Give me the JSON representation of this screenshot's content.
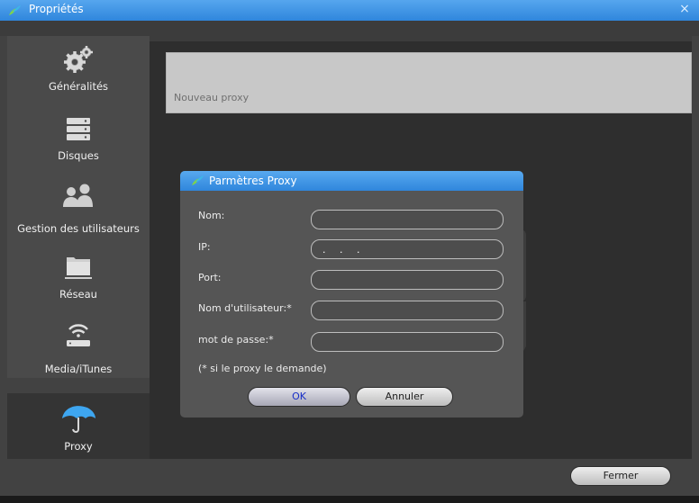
{
  "window": {
    "title": "Propriétés",
    "close": "×"
  },
  "sidebar": {
    "items": [
      {
        "label": "Généralités",
        "icon": "gears-icon"
      },
      {
        "label": "Disques",
        "icon": "server-disks-icon"
      },
      {
        "label": "Gestion des utilisateurs",
        "icon": "users-icon"
      },
      {
        "label": "Réseau",
        "icon": "network-folder-icon"
      },
      {
        "label": "Media/iTunes",
        "icon": "wifi-router-icon"
      },
      {
        "label": "Proxy",
        "icon": "umbrella-icon",
        "active": true
      }
    ]
  },
  "proxy_list": {
    "items": [
      "Nouveau proxy"
    ]
  },
  "dialog": {
    "title": "Parmètres Proxy",
    "fields": [
      {
        "label": "Nom:",
        "value": ""
      },
      {
        "label": "IP:",
        "value": ". . ."
      },
      {
        "label": "Port:",
        "value": ""
      },
      {
        "label": "Nom d'utilisateur:*",
        "value": ""
      },
      {
        "label": "mot de passe:*",
        "value": ""
      }
    ],
    "note": "(* si le proxy le demande)",
    "ok_label": "OK",
    "cancel_label": "Annuler"
  },
  "footer": {
    "close_label": "Fermer"
  },
  "colors": {
    "accent": "#2f86dc",
    "active_nav": "#343434",
    "nav": "#4a4a4a",
    "umbrella": "#3ea6f0"
  }
}
